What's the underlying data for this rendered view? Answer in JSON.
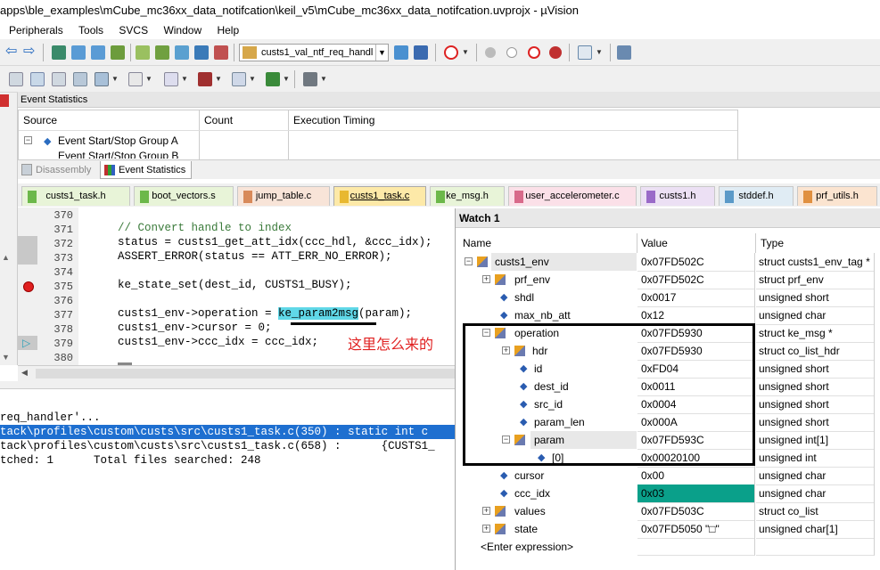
{
  "titlebar": {
    "title": "apps\\ble_examples\\mCube_mc36xx_data_notifcation\\keil_v5\\mCube_mc36xx_data_notifcation.uvprojx - µVision"
  },
  "menu": {
    "items": [
      "Peripherals",
      "Tools",
      "SVCS",
      "Window",
      "Help"
    ]
  },
  "toolbar": {
    "target_value": "custs1_val_ntf_req_handl"
  },
  "event_statistics": {
    "title": "Event Statistics",
    "columns": [
      "Source",
      "Count",
      "Execution Timing"
    ],
    "rows": [
      "Event Start/Stop Group A",
      "Event Start/Stop Group B"
    ]
  },
  "panel_tabs": [
    "Disassembly",
    "Event Statistics"
  ],
  "editor_tabs": [
    "custs1_task.h",
    "boot_vectors.s",
    "jump_table.c",
    "custs1_task.c",
    "ke_msg.h",
    "user_accelerometer.c",
    "custs1.h",
    "stddef.h",
    "prf_utils.h"
  ],
  "code": {
    "line_numbers": [
      "370",
      "371",
      "372",
      "373",
      "374",
      "375",
      "376",
      "377",
      "378",
      "379",
      "380"
    ],
    "lines": [
      "",
      "// Convert handle to index",
      "status = custs1_get_att_idx(ccc_hdl, &ccc_idx);",
      "ASSERT_ERROR(status == ATT_ERR_NO_ERROR);",
      "",
      "ke_state_set(dest_id, CUSTS1_BUSY);",
      "",
      "custs1_env->operation = ",
      "custs1_env->cursor = 0;",
      "custs1_env->ccc_idx = ccc_idx;",
      ""
    ],
    "highlight_func": "ke_param2msg",
    "highlight_rest": "(param);",
    "annotation": "这里怎么来的"
  },
  "find_results": [
    "req_handler'...",
    "tack\\profiles\\custom\\custs\\src\\custs1_task.c(350) : static int c",
    "tack\\profiles\\custom\\custs\\src\\custs1_task.c(658) :      {CUSTS1_",
    "tched: 1      Total files searched: 248"
  ],
  "watch": {
    "title": "Watch 1",
    "columns": [
      "Name",
      "Value",
      "Type"
    ],
    "rows": [
      {
        "name": "custs1_env",
        "value": "0x07FD502C",
        "type": "struct custs1_env_tag *"
      },
      {
        "name": "prf_env",
        "value": "0x07FD502C",
        "type": "struct prf_env"
      },
      {
        "name": "shdl",
        "value": "0x0017",
        "type": "unsigned short"
      },
      {
        "name": "max_nb_att",
        "value": "0x12",
        "type": "unsigned char"
      },
      {
        "name": "operation",
        "value": "0x07FD5930",
        "type": "struct ke_msg *"
      },
      {
        "name": "hdr",
        "value": "0x07FD5930",
        "type": "struct co_list_hdr"
      },
      {
        "name": "id",
        "value": "0xFD04",
        "type": "unsigned short"
      },
      {
        "name": "dest_id",
        "value": "0x0011",
        "type": "unsigned short"
      },
      {
        "name": "src_id",
        "value": "0x0004",
        "type": "unsigned short"
      },
      {
        "name": "param_len",
        "value": "0x000A",
        "type": "unsigned short"
      },
      {
        "name": "param",
        "value": "0x07FD593C",
        "type": "unsigned int[1]"
      },
      {
        "name": "[0]",
        "value": "0x00020100",
        "type": "unsigned int"
      },
      {
        "name": "cursor",
        "value": "0x00",
        "type": "unsigned char"
      },
      {
        "name": "ccc_idx",
        "value": "0x03",
        "type": "unsigned char"
      },
      {
        "name": "values",
        "value": "0x07FD503C",
        "type": "struct co_list"
      },
      {
        "name": "state",
        "value": "0x07FD5050 \"□\"",
        "type": "unsigned char[1]"
      },
      {
        "name": "<Enter expression>",
        "value": "",
        "type": ""
      }
    ]
  }
}
